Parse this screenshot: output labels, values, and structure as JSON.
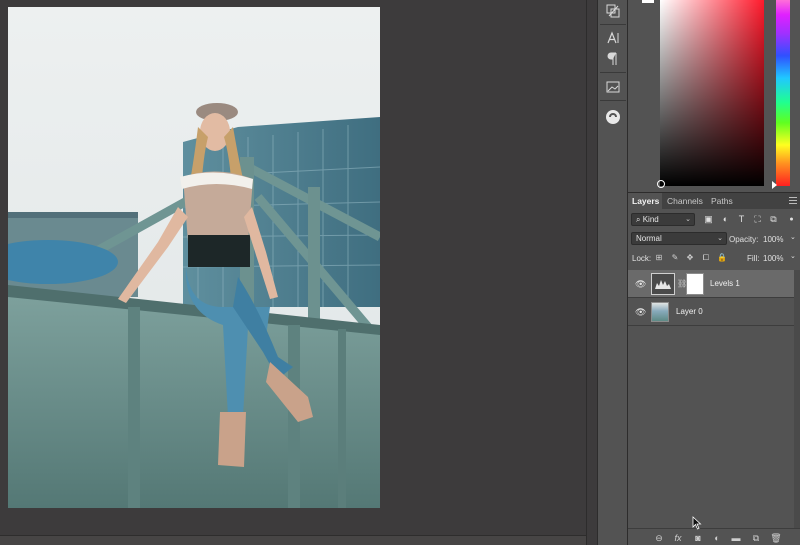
{
  "layers_panel": {
    "tabs": [
      {
        "label": "Layers"
      },
      {
        "label": "Channels"
      },
      {
        "label": "Paths"
      }
    ],
    "filter": {
      "label": "Kind"
    },
    "blend_mode": {
      "value": "Normal"
    },
    "opacity": {
      "label": "Opacity:",
      "value": "100%"
    },
    "lock": {
      "label": "Lock:"
    },
    "fill": {
      "label": "Fill:",
      "value": "100%"
    },
    "layers": [
      {
        "name": "Levels 1",
        "selected": true,
        "kind": "adjustment"
      },
      {
        "name": "Layer 0",
        "selected": false,
        "kind": "pixel"
      }
    ]
  },
  "dock": {
    "icons": [
      "history-icon",
      "character-icon",
      "paragraph-icon",
      "libraries-icon",
      "adjustments-icon"
    ]
  },
  "colors": {
    "workspace": "#3d3b3c",
    "panel": "#535353",
    "selected_row": "#6a6a6a",
    "hue_red": "#ff1a2c"
  }
}
